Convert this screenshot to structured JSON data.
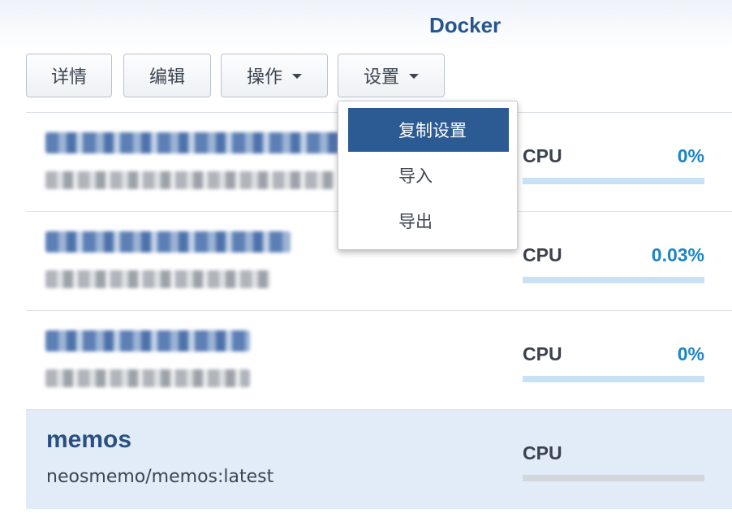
{
  "app": {
    "title": "Docker"
  },
  "toolbar": {
    "details_label": "详情",
    "edit_label": "编辑",
    "actions_label": "操作",
    "settings_label": "设置"
  },
  "settings_menu": {
    "items": [
      {
        "label": "复制设置",
        "active": true
      },
      {
        "label": "导入",
        "active": false
      },
      {
        "label": "导出",
        "active": false
      }
    ]
  },
  "containers": [
    {
      "name": "",
      "image": "",
      "cpu_label": "CPU",
      "cpu_value": "0%",
      "cpu_fraction": 0,
      "obscured": true
    },
    {
      "name": "",
      "image": "",
      "cpu_label": "CPU",
      "cpu_value": "0.03%",
      "cpu_fraction": 0.0003,
      "obscured": true
    },
    {
      "name": "",
      "image": "",
      "cpu_label": "CPU",
      "cpu_value": "0%",
      "cpu_fraction": 0,
      "obscured": true
    },
    {
      "name": "memos",
      "image": "neosmemo/memos:latest",
      "cpu_label": "CPU",
      "cpu_value": "",
      "cpu_fraction": 0,
      "obscured": false,
      "selected": true
    }
  ],
  "colors": {
    "brand": "#25558c",
    "menu_active_bg": "#2c5a92",
    "cpu_value": "#1d84c6",
    "cpu_track": "#c9e1f5",
    "selected_row_bg": "#e1ecf8"
  }
}
